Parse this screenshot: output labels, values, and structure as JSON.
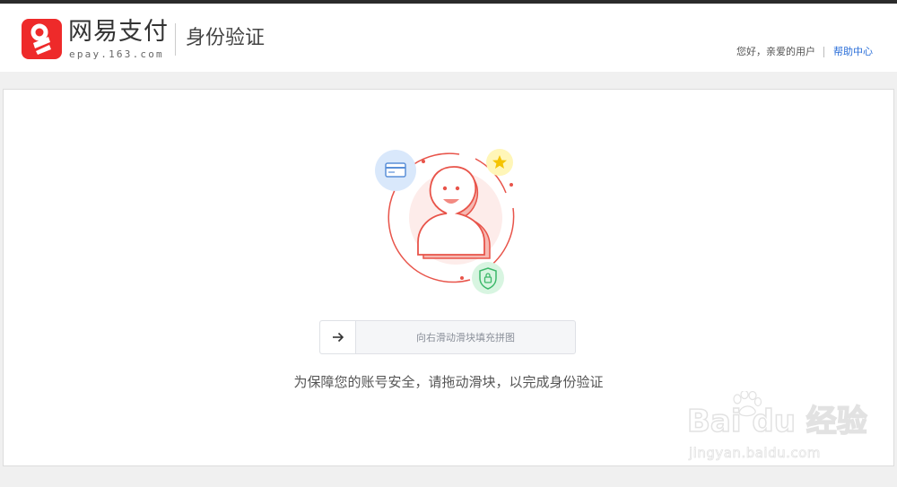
{
  "header": {
    "brand_name": "网易支付",
    "brand_sub": "epay.163.com",
    "page_heading": "身份验证",
    "greeting": "您好，亲爱的用户",
    "help_link": "帮助中心"
  },
  "verification": {
    "slider_hint": "向右滑动滑块填充拼图",
    "notice": "为保障您的账号安全，请拖动滑块，以完成身份验证"
  },
  "watermark": {
    "main": "Bai du 经验",
    "sub": "jingyan.baidu.com"
  },
  "colors": {
    "brand_red": "#ee2a2a",
    "link_blue": "#2a6ed8",
    "illustration_red": "#e8544a"
  },
  "icons": [
    "epay-logo-icon",
    "card-icon",
    "star-icon",
    "shield-lock-icon",
    "arrow-right-icon",
    "baidu-paw-icon"
  ]
}
